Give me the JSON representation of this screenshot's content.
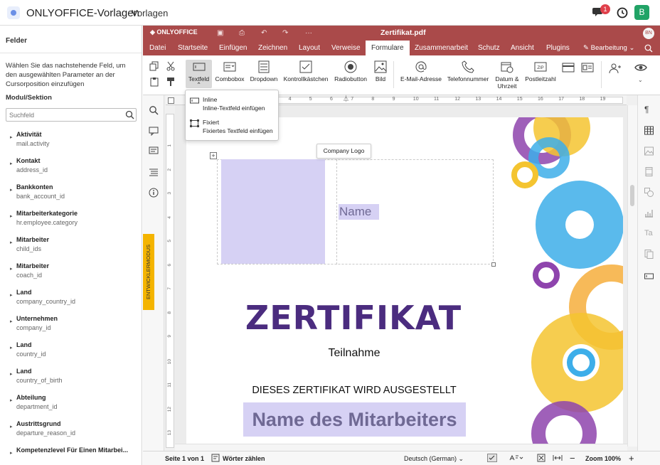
{
  "app": {
    "title": "ONLYOFFICE-Vorlagen",
    "subtitle": "Vorlagen",
    "notification_count": "1",
    "user_initial": "B"
  },
  "left_panel": {
    "title": "Felder",
    "description": "Wählen Sie das nachstehende Feld, um den ausgewählten Parameter an der Cursorposition einzufügen",
    "section_label": "Modul/Sektion",
    "search_placeholder": "Suchfeld",
    "fields": [
      {
        "name": "Aktivität",
        "id": "mail.activity"
      },
      {
        "name": "Kontakt",
        "id": "address_id"
      },
      {
        "name": "Bankkonten",
        "id": "bank_account_id"
      },
      {
        "name": "Mitarbeiterkategorie",
        "id": "hr.employee.category"
      },
      {
        "name": "Mitarbeiter",
        "id": "child_ids"
      },
      {
        "name": "Mitarbeiter",
        "id": "coach_id"
      },
      {
        "name": "Land",
        "id": "company_country_id"
      },
      {
        "name": "Unternehmen",
        "id": "company_id"
      },
      {
        "name": "Land",
        "id": "country_id"
      },
      {
        "name": "Land",
        "id": "country_of_birth"
      },
      {
        "name": "Abteilung",
        "id": "department_id"
      },
      {
        "name": "Austrittsgrund",
        "id": "departure_reason_id"
      },
      {
        "name": "Kompetenzlevel Für Einen Mitarbei...",
        "id": ""
      }
    ]
  },
  "editor": {
    "brand": "ONLYOFFICE",
    "doc_title": "Zertifikat.pdf",
    "user_badge": "BN",
    "tabs": [
      "Datei",
      "Startseite",
      "Einfügen",
      "Zeichnen",
      "Layout",
      "Verweise",
      "Formulare",
      "Zusammenarbeit",
      "Schutz",
      "Ansicht",
      "Plugins"
    ],
    "active_tab": "Formulare",
    "edit_mode": "Bearbeitung",
    "ribbon": {
      "textfeld": "Textfeld",
      "combobox": "Combobox",
      "dropdown": "Dropdown",
      "kontrollkaestchen": "Kontrollkästchen",
      "radiobutton": "Radiobutton",
      "bild": "Bild",
      "email": "E-Mail-Adresse",
      "telefon": "Telefonnummer",
      "datum_line1": "Datum &",
      "datum_line2": "Uhrzeit",
      "postleitzahl": "Postleitzahl",
      "zip_glyph": "ZIP"
    },
    "dropdown_menu": [
      {
        "title": "Inline",
        "desc": "Inline-Textfeld einfügen"
      },
      {
        "title": "Fixiert",
        "desc": "Fixiertes Textfeld einfügen"
      }
    ],
    "developer_mode": "ENTWICKLERMODUS",
    "ruler_numbers": [
      "1",
      "2",
      "3",
      "4",
      "5",
      "6",
      "7",
      "8",
      "9",
      "10",
      "11",
      "12",
      "13",
      "14",
      "15",
      "16",
      "17",
      "18",
      "19"
    ],
    "vruler_numbers": [
      "1",
      "2",
      "3",
      "4",
      "5",
      "6",
      "7",
      "8",
      "9",
      "10",
      "11",
      "12",
      "13"
    ]
  },
  "document": {
    "tooltip": "Company Logo",
    "name_field": "Name",
    "title": "ZERTIFIKAT",
    "subtitle": "Teilnahme",
    "statement": "DIESES ZERTIFIKAT WIRD AUSGESTELLT",
    "employee_field": "Name des Mitarbeiters"
  },
  "status_bar": {
    "page": "Seite 1 von 1",
    "word_count": "Wörter zählen",
    "language": "Deutsch (German)",
    "zoom": "Zoom 100%"
  },
  "colors": {
    "accent": "#aa4a4a",
    "field_highlight": "#d6d1f4",
    "title_purple": "#4b2c7f",
    "dev_mode": "#f4b400",
    "avatar_green": "#21a366"
  }
}
